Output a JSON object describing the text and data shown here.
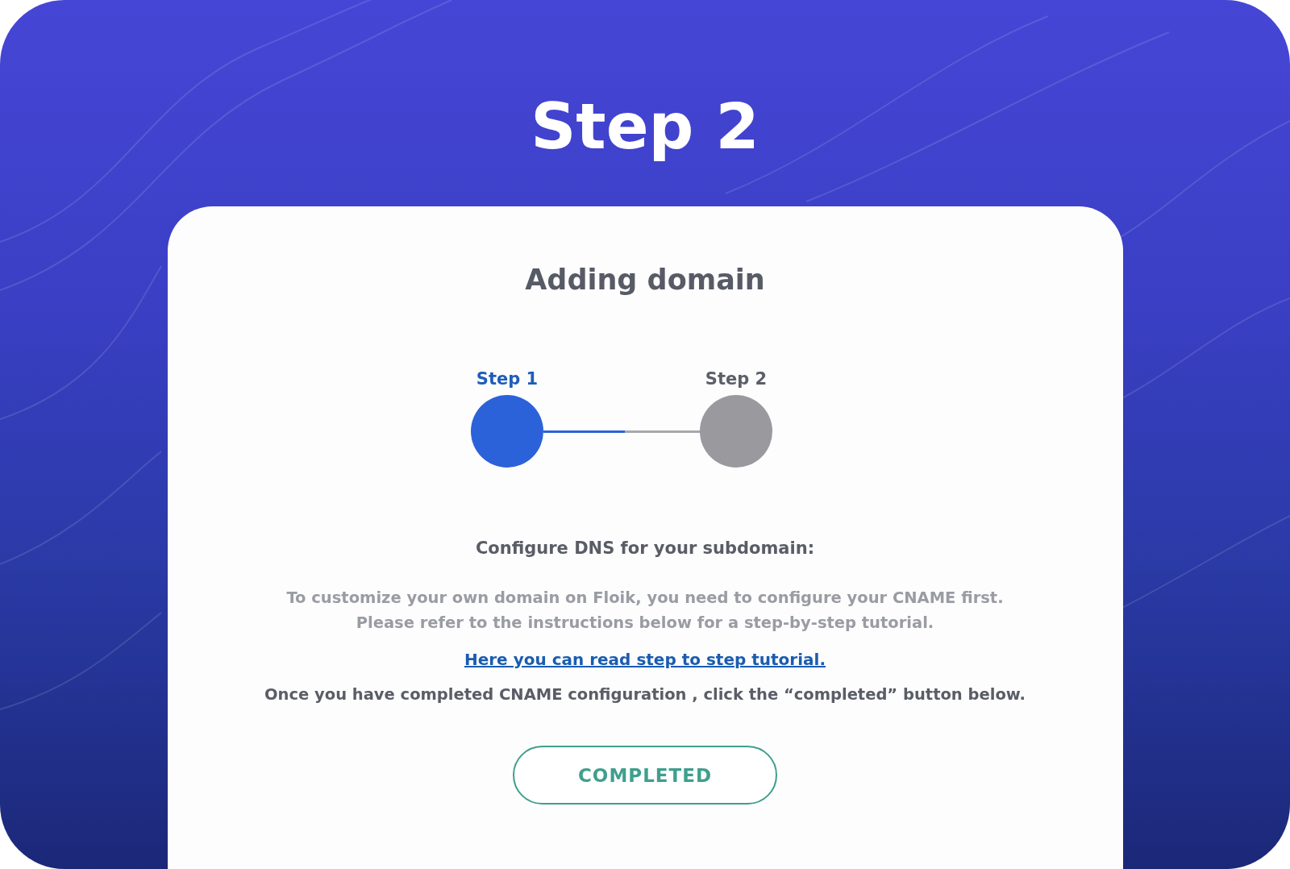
{
  "page_title": "Step 2",
  "card": {
    "title": "Adding domain",
    "steps": [
      {
        "label": "Step 1",
        "selected": true
      },
      {
        "label": "Step 2",
        "selected": false
      }
    ],
    "connector": {
      "level": 0.52
    },
    "subtitle": "Configure DNS for your subdomain:",
    "description": [
      "To customize your own domain on Floik, you need to configure your CNAME first.",
      "Please refer to the instructions below for a step-by-step tutorial."
    ],
    "link": "Here you can read step to step tutorial.",
    "note": "Once you have completed CNAME configuration , click the “completed” button below.",
    "button": "COMPLETED"
  }
}
